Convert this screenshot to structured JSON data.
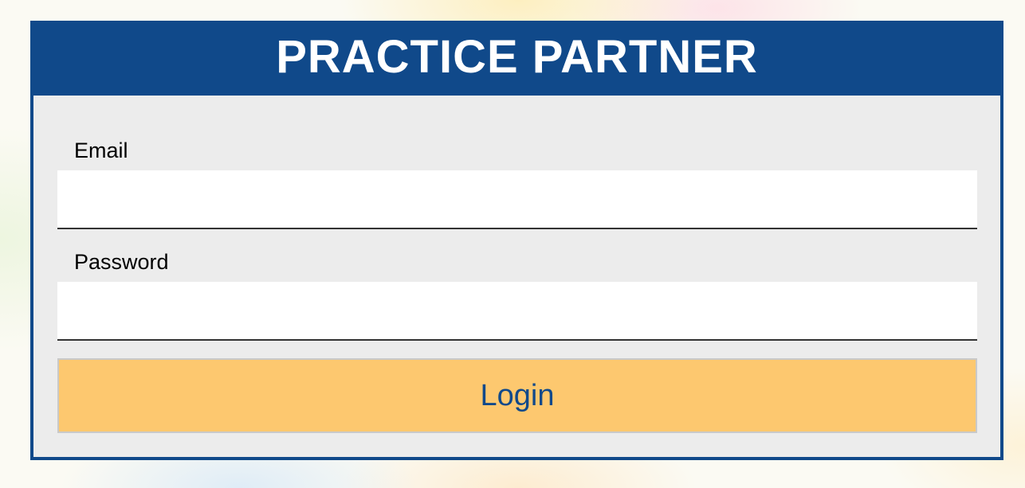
{
  "header": {
    "title": "PRACTICE PARTNER"
  },
  "form": {
    "email_label": "Email",
    "email_value": "",
    "password_label": "Password",
    "password_value": "",
    "login_label": "Login"
  },
  "colors": {
    "brand_blue": "#10498a",
    "button_yellow": "#fdc86f",
    "panel_gray": "#ececec"
  }
}
